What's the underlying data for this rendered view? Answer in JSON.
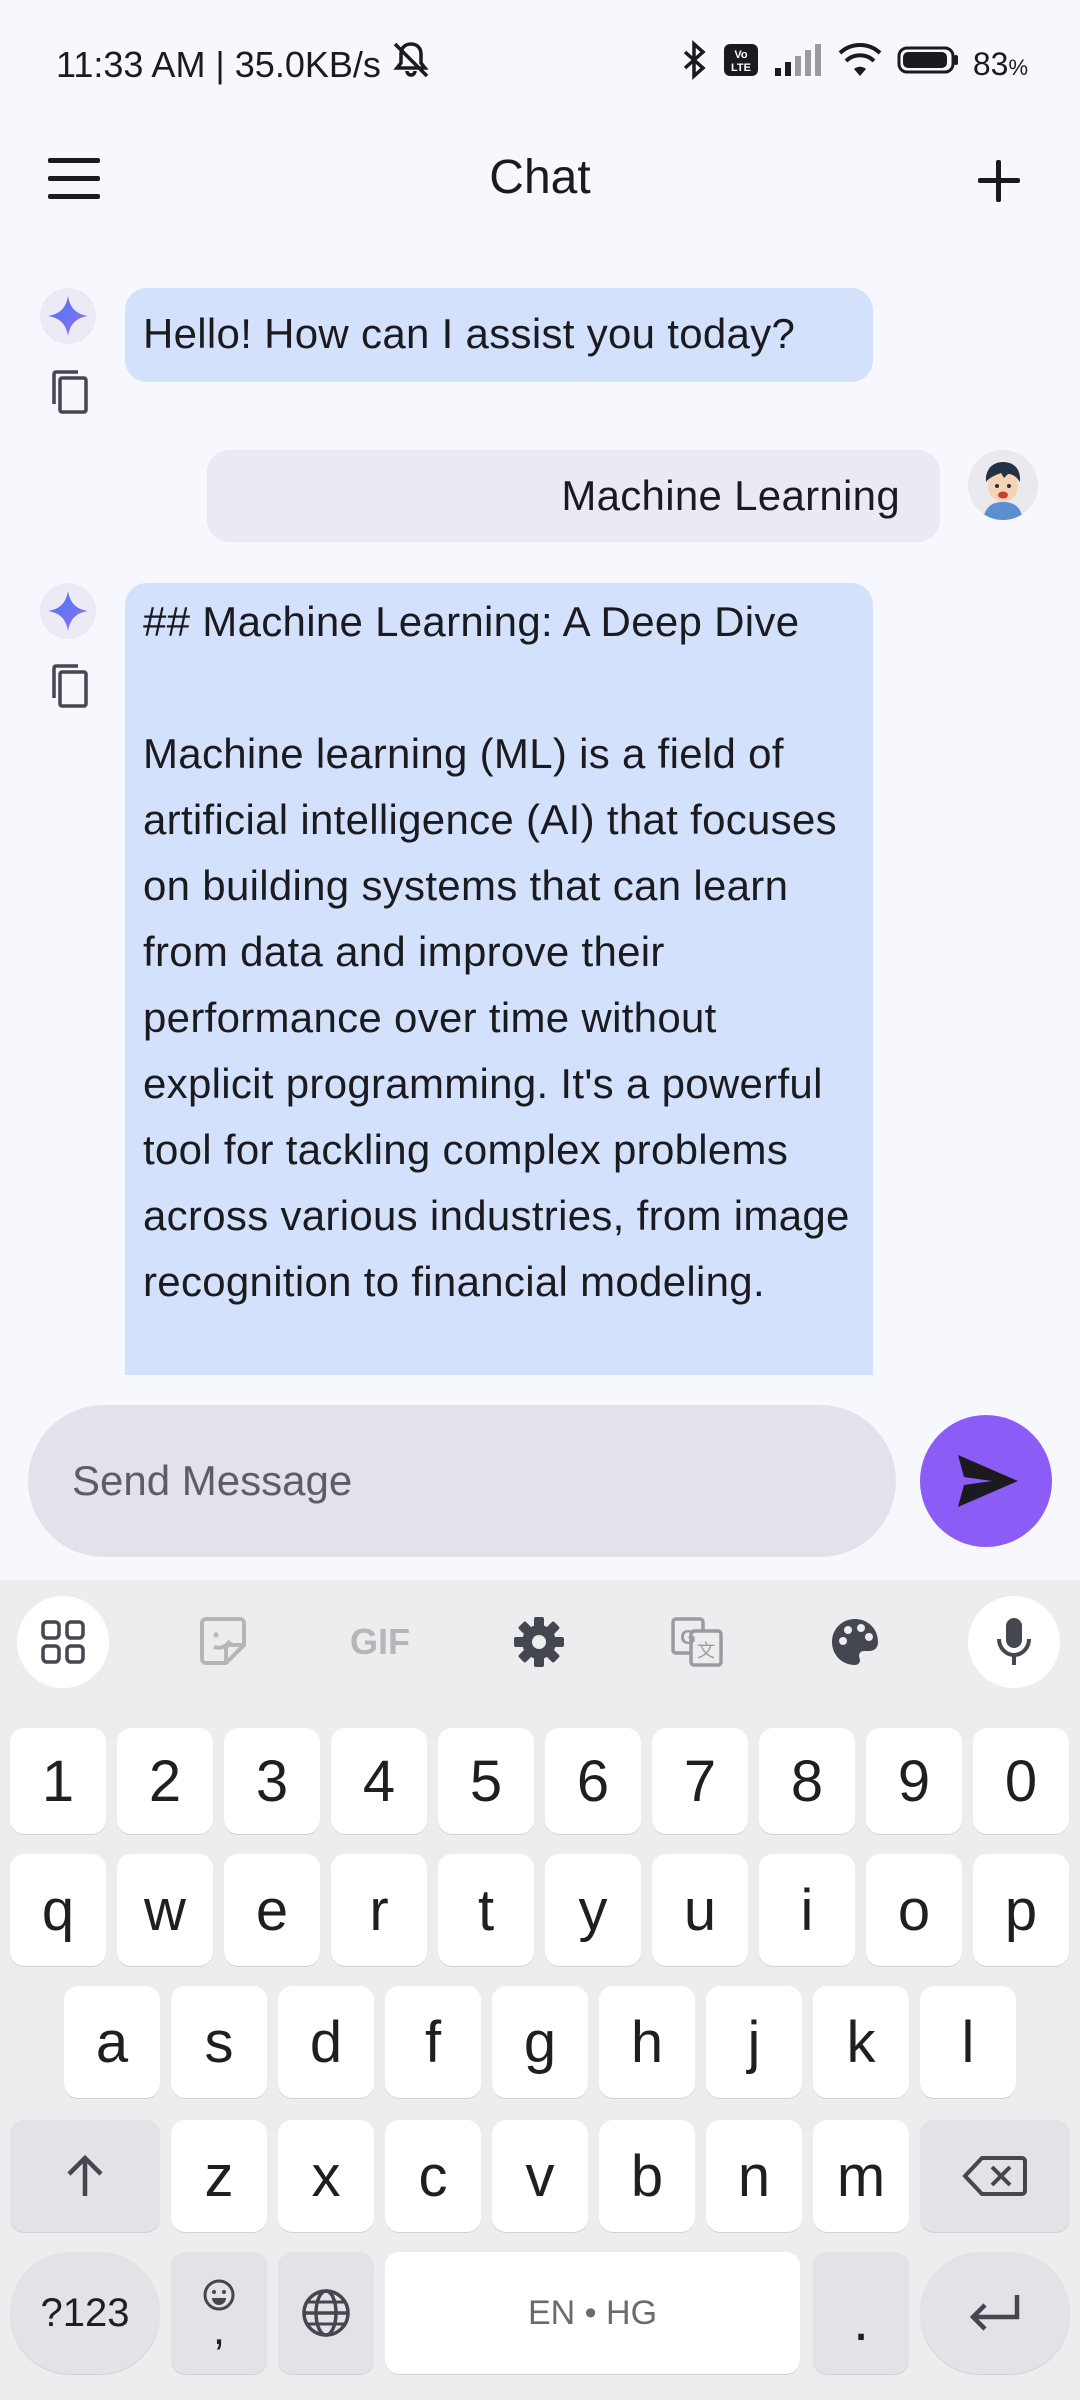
{
  "status_bar": {
    "time_net": "11:33 AM | 35.0KB/s",
    "battery": "83",
    "battery_unit": "%",
    "volte": "Vo LTE"
  },
  "app_bar": {
    "title": "Chat"
  },
  "messages": [
    {
      "role": "bot",
      "text": "Hello! How can I assist you today?"
    },
    {
      "role": "user",
      "text": "Machine Learning"
    },
    {
      "role": "bot",
      "heading": "## Machine Learning: A Deep Dive",
      "body": "Machine learning (ML) is a field of artificial intelligence (AI) that focuses on building systems that can learn from data and improve their performance over time without explicit programming. It's a powerful tool for tackling complex problems across various industries, from image recognition to financial modeling."
    }
  ],
  "composer": {
    "placeholder": "Send Message"
  },
  "keyboard": {
    "toolbar": [
      "apps-grid-icon",
      "sticker-icon",
      "gif",
      "settings-icon",
      "translate-icon",
      "palette-icon",
      "mic-icon"
    ],
    "gif_label": "GIF",
    "row_numbers": [
      "1",
      "2",
      "3",
      "4",
      "5",
      "6",
      "7",
      "8",
      "9",
      "0"
    ],
    "row1": [
      "q",
      "w",
      "e",
      "r",
      "t",
      "y",
      "u",
      "i",
      "o",
      "p"
    ],
    "row2": [
      "a",
      "s",
      "d",
      "f",
      "g",
      "h",
      "j",
      "k",
      "l"
    ],
    "row3": [
      "z",
      "x",
      "c",
      "v",
      "b",
      "n",
      "m"
    ],
    "symbols_label": "?123",
    "emoji_comma": ",",
    "space_label": "EN • HG",
    "period": "."
  }
}
